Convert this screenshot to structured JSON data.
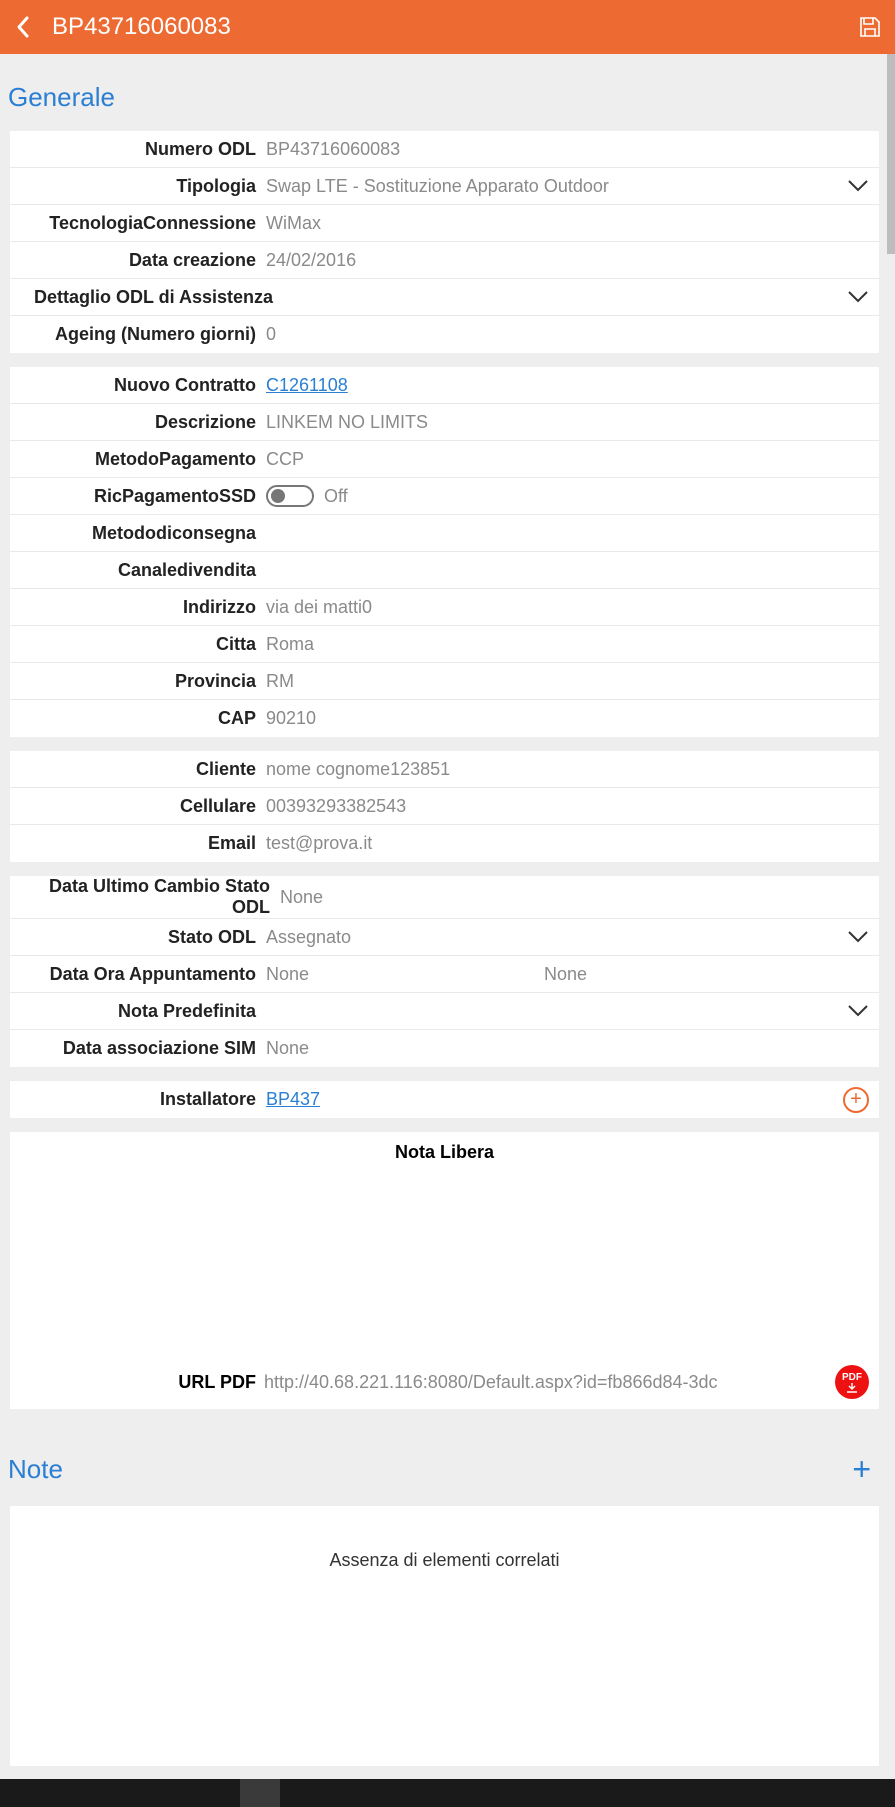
{
  "header": {
    "title": "BP43716060083"
  },
  "section_generale": "Generale",
  "g1": {
    "numero_odl_l": "Numero ODL",
    "numero_odl_v": "BP43716060083",
    "tipologia_l": "Tipologia",
    "tipologia_v": "Swap LTE - Sostituzione Apparato Outdoor",
    "tecnologia_l": "TecnologiaConnessione",
    "tecnologia_v": "WiMax",
    "datacrea_l": "Data creazione",
    "datacrea_v": "24/02/2016",
    "dettaglio_l": "Dettaglio ODL di Assistenza",
    "ageing_l": "Ageing (Numero giorni)",
    "ageing_v": "0"
  },
  "g2": {
    "contratto_l": "Nuovo Contratto",
    "contratto_v": "C1261108",
    "descrizione_l": "Descrizione",
    "descrizione_v": "LINKEM NO LIMITS",
    "metodopag_l": "MetodoPagamento",
    "metodopag_v": "CCP",
    "ricpag_l": "RicPagamentoSSD",
    "ricpag_state": "Off",
    "metodocon_l": "Metododiconsegna",
    "canale_l": "Canaledivendita",
    "indirizzo_l": "Indirizzo",
    "indirizzo_v": "via dei matti0",
    "citta_l": "Citta",
    "citta_v": "Roma",
    "provincia_l": "Provincia",
    "provincia_v": "RM",
    "cap_l": "CAP",
    "cap_v": "90210"
  },
  "g3": {
    "cliente_l": "Cliente",
    "cliente_v": "nome cognome123851",
    "cellulare_l": "Cellulare",
    "cellulare_v": "00393293382543",
    "email_l": "Email",
    "email_v": "test@prova.it"
  },
  "g4": {
    "ultimocambio_l": "Data Ultimo Cambio Stato ODL",
    "ultimocambio_v": "None",
    "statoodl_l": "Stato ODL",
    "statoodl_v": "Assegnato",
    "dataora_l": "Data Ora Appuntamento",
    "dataora_v1": "None",
    "dataora_v2": "None",
    "notapred_l": "Nota Predefinita",
    "datasim_l": "Data associazione SIM",
    "datasim_v": "None"
  },
  "g5": {
    "installatore_l": "Installatore",
    "installatore_v": "BP437"
  },
  "nota": {
    "title": "Nota Libera",
    "urlpdf_l": "URL PDF",
    "urlpdf_v": "http://40.68.221.116:8080/Default.aspx?id=fb866d84-3dc",
    "pdf_badge": "PDF"
  },
  "section_note": "Note",
  "empty_text": "Assenza di elementi correlati"
}
